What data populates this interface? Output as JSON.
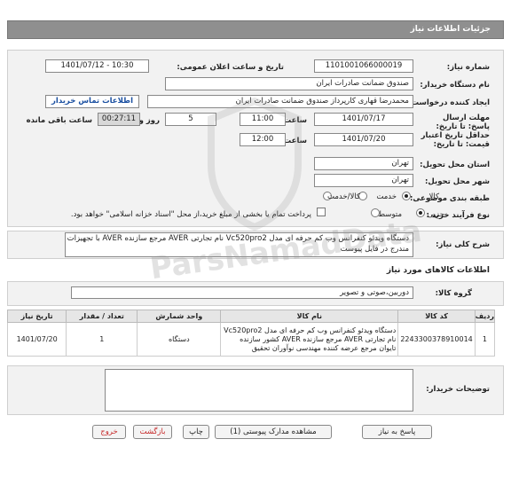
{
  "header": {
    "title": "جزئیات اطلاعات نیاز"
  },
  "form": {
    "need_number_label": "شماره نیاز:",
    "need_number": "1101001066000019",
    "announce_label": "تاریخ و ساعت اعلان عمومی:",
    "announce_value": "1401/07/12 - 10:30",
    "buyer_org_label": "نام دستگاه خریدار:",
    "buyer_org": "صندوق ضمانت صادرات ایران",
    "creator_label": "ایجاد کننده درخواست:",
    "creator": "محمدرضا قهاری کارپرداز صندوق ضمانت صادرات ایران",
    "contact_link": "اطلاعات تماس خریدار",
    "deadline_label": "مهلت ارسال پاسخ: تا تاریخ:",
    "deadline_date": "1401/07/17",
    "time_label": "ساعت",
    "deadline_time": "11:00",
    "days": "5",
    "day_and_label": "روز و",
    "remaining": "00:27:11",
    "remaining_label": "ساعت باقی مانده",
    "validity_label": "حداقل تاریخ اعتبار قیمت: تا تاریخ:",
    "validity_date": "1401/07/20",
    "validity_time_label": "ساعت",
    "validity_time": "12:00",
    "province_label": "استان محل تحویل:",
    "province": "تهران",
    "city_label": "شهر محل تحویل:",
    "city": "تهران",
    "category_label": "طبقه بندی موضوعی:",
    "category_options": [
      "کالا",
      "خدمت",
      "کالا/خدمت"
    ],
    "process_label": "نوع فرآیند خرید :",
    "process_options": [
      "جزیی",
      "متوسط"
    ],
    "payment_note": "پرداخت تمام یا بخشی از مبلغ خرید،از محل \"اسناد خزانه اسلامی\" خواهد بود."
  },
  "summary": {
    "label": "شرح کلی نیاز:",
    "text": "دستگاه ویدئو کنفرانس وب کم حرفه ای مدل Vc520pro2 نام تجارتی AVER مرجع سازنده AVER با تجهیزات مندرج در فایل پیوست"
  },
  "goods": {
    "section_title": "اطلاعات کالاهای مورد نیاز",
    "group_label": "گروه کالا:",
    "group_value": "دوربین،صوتی و تصویر",
    "columns": [
      "ردیف",
      "کد کالا",
      "نام کالا",
      "واحد شمارش",
      "تعداد / مقدار",
      "تاریخ نیاز"
    ],
    "rows": [
      {
        "row": "1",
        "code": "2243300378910014",
        "name": "دستگاه ویدئو کنفرانس وب کم حرفه ای مدل Vc520pro2 نام تجارتی AVER مرجع سازنده AVER کشور سازنده تایوان مرجع عرضه کننده مهندسی نوآوران تحقیق",
        "unit": "دستگاه",
        "qty": "1",
        "date": "1401/07/20"
      }
    ]
  },
  "buyer_notes": {
    "label": "توضیحات خریدار:",
    "value": ""
  },
  "buttons": {
    "reply": "پاسخ به نیاز",
    "docs": "مشاهده مدارک پیوستی (1)",
    "print": "چاپ",
    "back": "بازگشت",
    "exit": "خروج"
  },
  "watermark": {
    "brand": "ParsNamadData"
  }
}
